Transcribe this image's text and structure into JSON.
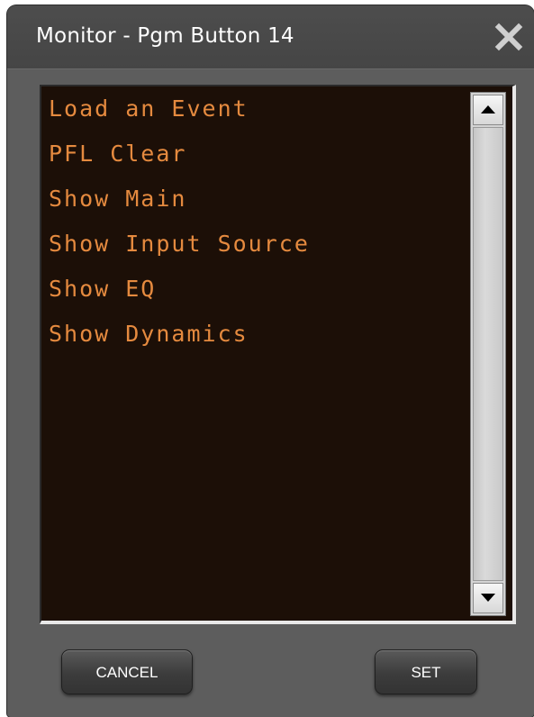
{
  "window": {
    "title": "Monitor - Pgm Button 14",
    "close_icon": "close-icon"
  },
  "list": {
    "items": [
      "Load an Event",
      "PFL Clear",
      "Show Main",
      "Show Input Source",
      "Show EQ",
      "Show Dynamics"
    ],
    "text_color": "#e58a3f",
    "background_color": "#1c0f07"
  },
  "scrollbar": {
    "up_icon": "arrow-up-icon",
    "down_icon": "arrow-down-icon"
  },
  "buttons": {
    "cancel_label": "CANCEL",
    "set_label": "SET"
  }
}
